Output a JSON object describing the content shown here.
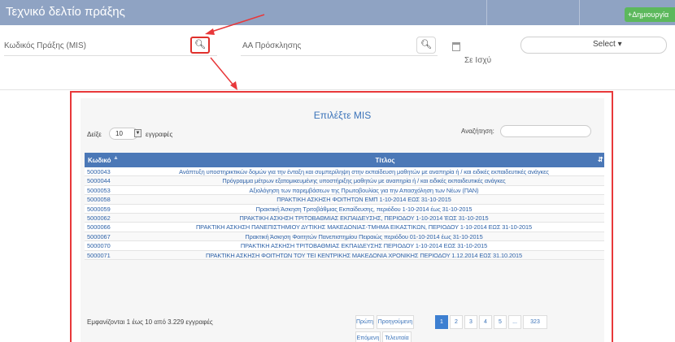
{
  "header": {
    "title": "Τεχνικό δελτίο πράξης",
    "create_button": "+Δημιουργία"
  },
  "filters": {
    "mis_code_label": "Κωδικός Πράξης (MIS)",
    "search_icon": "🔍",
    "call_number_label": "ΑΑ Πρόσκλησης",
    "in_force_label": "Σε Ισχύ",
    "select_label": "Select ▾"
  },
  "modal": {
    "title": "Επιλέξτε MIS",
    "show_label": "Δείξε",
    "page_length": "10",
    "entries_label": "εγγραφές",
    "search_label": "Αναζήτηση:",
    "columns": {
      "code": "Κωδικό",
      "title": "Τίτλος"
    },
    "rows": [
      {
        "code": "5000043",
        "title": "Ανάπτυξη υποστηρικτικών δομών για την ένταξη και συμπερίληψη στην εκπαίδευση μαθητών με αναπηρία ή / και ειδικές εκπαιδευτικές ανάγκες"
      },
      {
        "code": "5000044",
        "title": "Πρόγραμμα μέτρων εξατομικευμένης υποστήριξης μαθητών με αναπηρία ή / και ειδικές εκπαιδευτικές ανάγκες"
      },
      {
        "code": "5000053",
        "title": "Αξιολόγηση των παρεμβάσεων της Πρωτοβουλίας για την Απασχόληση των Νέων (ΠΑΝ)"
      },
      {
        "code": "5000058",
        "title": "ΠΡΑΚΤΙΚΗ ΑΣΚΗΣΗ ΦΟΙΤΗΤΩΝ ΕΜΠ 1-10-2014 ΕΩΣ 31-10-2015"
      },
      {
        "code": "5000059",
        "title": "Πρακτική Άσκηση Τριτοβάθμιας Εκπαίδευσης, περιόδου 1-10-2014 έως 31-10-2015"
      },
      {
        "code": "5000062",
        "title": "ΠΡΑΚΤΙΚΗ ΑΣΚΗΣΗ ΤΡΙΤΟΒΑΘΜΙΑΣ ΕΚΠΑΙΔΕΥΣΗΣ, ΠΕΡΙΟΔΟΥ 1-10-2014 ΈΩΣ 31-10-2015"
      },
      {
        "code": "5000066",
        "title": "ΠΡΑΚΤΙΚΗ ΑΣΚΗΣΗ ΠΑΝΕΠΙΣΤΗΜΙΟΥ ΔΥΤΙΚΗΣ ΜΑΚΕΔΟΝΙΑΣ-ΤΜΗΜΑ ΕΙΚΑΣΤΙΚΩΝ, ΠΕΡΙΟΔΟΥ 1-10-2014 ΕΩΣ 31-10-2015"
      },
      {
        "code": "5000067",
        "title": "Πρακτική Άσκηση Φοιτητών Πανεπιστημίου Πειραιώς περιόδου 01-10-2014 έως 31-10-2015"
      },
      {
        "code": "5000070",
        "title": "ΠΡΑΚΤΙΚΗ ΑΣΚΗΣΗ ΤΡΙΤΟΒΑΘΜΙΑΣ ΕΚΠΑΙΔΕΥΣΗΣ ΠΕΡΙΟΔΟΥ 1-10-2014 ΕΩΣ 31-10-2015"
      },
      {
        "code": "5000071",
        "title": "ΠΡΑΚΤΙΚΗ ΑΣΚΗΣΗ ΦΟΙΤΗΤΩΝ ΤΟΥ ΤΕΙ ΚΕΝΤΡΙΚΗΣ ΜΑΚΕΔΟΝΙΑ ΧΡΟΝΙΚΗΣ ΠΕΡΙΟΔΟΥ 1.12.2014 ΕΩΣ 31.10.2015"
      }
    ],
    "info": "Εμφανίζονται 1 έως 10 από 3.229 εγγραφές",
    "pagination": {
      "first": "Πρώτη",
      "previous": "Προηγούμενη",
      "pages": [
        "1",
        "2",
        "3",
        "4",
        "5",
        "...",
        "323"
      ],
      "next": "Επόμενη",
      "last": "Τελευταία",
      "current_page": "1"
    }
  },
  "colors": {
    "topbar": "#8fa3c3",
    "create_button": "#5cb85c",
    "annotation_red": "#e8383a",
    "table_header": "#4b78b7",
    "link_blue": "#2e62a8"
  }
}
